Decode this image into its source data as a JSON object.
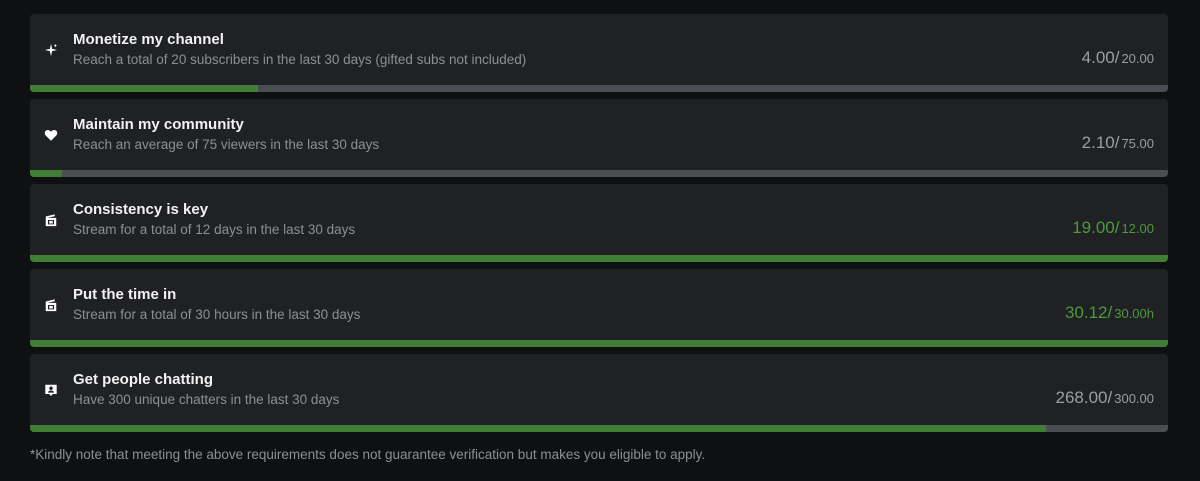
{
  "requirements": [
    {
      "title": "Monetize my channel",
      "description": "Reach a total of 20 subscribers in the last 30 days (gifted subs not included)",
      "current": "4.00/",
      "target": "20.00",
      "progress": 0.2,
      "icon": "sparkle-icon",
      "complete": false
    },
    {
      "title": "Maintain my community",
      "description": "Reach an average of 75 viewers in the last 30 days",
      "current": "2.10/",
      "target": "75.00",
      "progress": 0.028,
      "icon": "heart-icon",
      "complete": false
    },
    {
      "title": "Consistency is key",
      "description": "Stream for a total of 12 days in the last 30 days",
      "current": "19.00/",
      "target": "12.00",
      "progress": 1.0,
      "icon": "calendar-icon",
      "complete": true
    },
    {
      "title": "Put the time in",
      "description": "Stream for a total of 30 hours in the last 30 days",
      "current": "30.12/",
      "target": "30.00h",
      "progress": 1.0,
      "icon": "calendar-icon",
      "complete": true
    },
    {
      "title": "Get people chatting",
      "description": "Have 300 unique chatters in the last 30 days",
      "current": "268.00/",
      "target": "300.00",
      "progress": 0.893,
      "icon": "chat-user-icon",
      "complete": false
    }
  ],
  "note": "*Kindly note that meeting the above requirements does not guarantee verification but makes you eligible to apply.",
  "colors": {
    "background": "#0e1011",
    "card": "#202124",
    "track": "#4a4d52",
    "fill": "#3f7e34",
    "complete_text": "#4c9a3a"
  }
}
